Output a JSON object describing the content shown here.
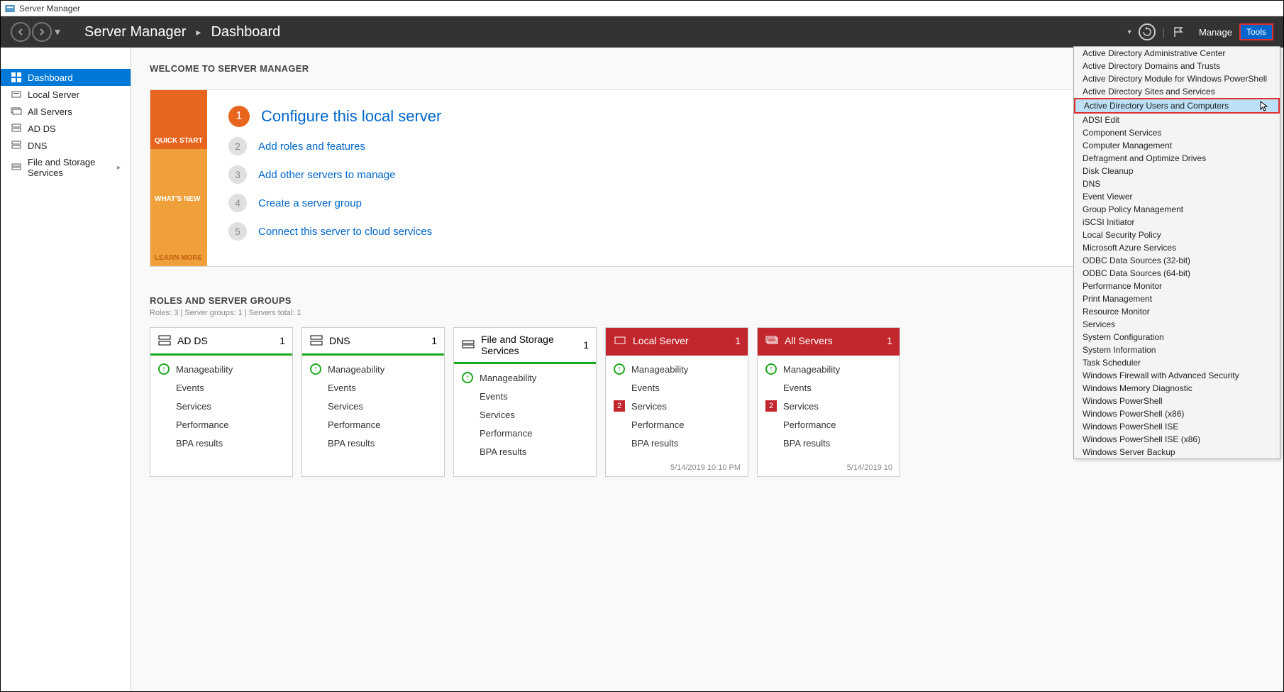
{
  "window_title": "Server Manager",
  "breadcrumb": {
    "root": "Server Manager",
    "page": "Dashboard"
  },
  "header_menu": {
    "manage": "Manage",
    "tools": "Tools"
  },
  "sidebar": {
    "items": [
      {
        "label": "Dashboard",
        "active": true
      },
      {
        "label": "Local Server"
      },
      {
        "label": "All Servers"
      },
      {
        "label": "AD DS"
      },
      {
        "label": "DNS"
      },
      {
        "label": "File and Storage Services",
        "expandable": true
      }
    ]
  },
  "welcome": {
    "title": "WELCOME TO SERVER MANAGER",
    "tabs": {
      "quick_start": "QUICK START",
      "whats_new": "WHAT'S NEW",
      "learn_more": "LEARN MORE"
    },
    "steps": [
      {
        "num": "1",
        "text": "Configure this local server",
        "primary": true
      },
      {
        "num": "2",
        "text": "Add roles and features"
      },
      {
        "num": "3",
        "text": "Add other servers to manage"
      },
      {
        "num": "4",
        "text": "Create a server group"
      },
      {
        "num": "5",
        "text": "Connect this server to cloud services"
      }
    ]
  },
  "roles": {
    "title": "ROLES AND SERVER GROUPS",
    "subtitle": "Roles: 3   |   Server groups: 1   |   Servers total: 1",
    "row_labels": {
      "manageability": "Manageability",
      "events": "Events",
      "services": "Services",
      "performance": "Performance",
      "bpa": "BPA results"
    },
    "tiles": [
      {
        "name": "AD DS",
        "count": "1",
        "red": false,
        "services_alert": null,
        "timestamp": ""
      },
      {
        "name": "DNS",
        "count": "1",
        "red": false,
        "services_alert": null,
        "timestamp": ""
      },
      {
        "name": "File and Storage Services",
        "count": "1",
        "red": false,
        "services_alert": null,
        "timestamp": ""
      },
      {
        "name": "Local Server",
        "count": "1",
        "red": true,
        "services_alert": "2",
        "timestamp": "5/14/2019 10:10 PM"
      },
      {
        "name": "All Servers",
        "count": "1",
        "red": true,
        "services_alert": "2",
        "timestamp": "5/14/2019 10"
      }
    ]
  },
  "tools_menu": [
    "Active Directory Administrative Center",
    "Active Directory Domains and Trusts",
    "Active Directory Module for Windows PowerShell",
    "Active Directory Sites and Services",
    "Active Directory Users and Computers",
    "ADSI Edit",
    "Component Services",
    "Computer Management",
    "Defragment and Optimize Drives",
    "Disk Cleanup",
    "DNS",
    "Event Viewer",
    "Group Policy Management",
    "iSCSI Initiator",
    "Local Security Policy",
    "Microsoft Azure Services",
    "ODBC Data Sources (32-bit)",
    "ODBC Data Sources (64-bit)",
    "Performance Monitor",
    "Print Management",
    "Resource Monitor",
    "Services",
    "System Configuration",
    "System Information",
    "Task Scheduler",
    "Windows Firewall with Advanced Security",
    "Windows Memory Diagnostic",
    "Windows PowerShell",
    "Windows PowerShell (x86)",
    "Windows PowerShell ISE",
    "Windows PowerShell ISE (x86)",
    "Windows Server Backup"
  ],
  "tools_menu_highlight_index": 4
}
